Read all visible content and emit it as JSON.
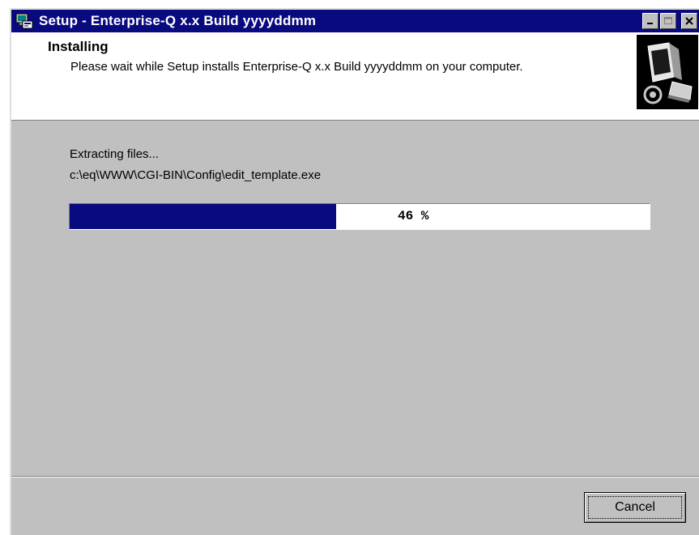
{
  "window": {
    "title": "Setup - Enterprise-Q x.x Build yyyyddmm",
    "controls": {
      "minimize": "_",
      "maximize": "□",
      "close": "x"
    }
  },
  "header": {
    "title": "Installing",
    "subtitle": "Please wait while Setup installs Enterprise-Q x.x Build yyyyddmm on your computer.",
    "graphic_icon": "computer-install-icon"
  },
  "body": {
    "status": "Extracting files...",
    "file_path": "c:\\eq\\WWW\\CGI-BIN\\Config\\edit_template.exe",
    "progress": {
      "percent": 46,
      "label": "46 %"
    }
  },
  "footer": {
    "cancel_label": "Cancel"
  },
  "colors": {
    "titlebar": "#0a0a80",
    "progress_fill": "#0a0a80",
    "dialog_bg": "#c0c0c0"
  }
}
